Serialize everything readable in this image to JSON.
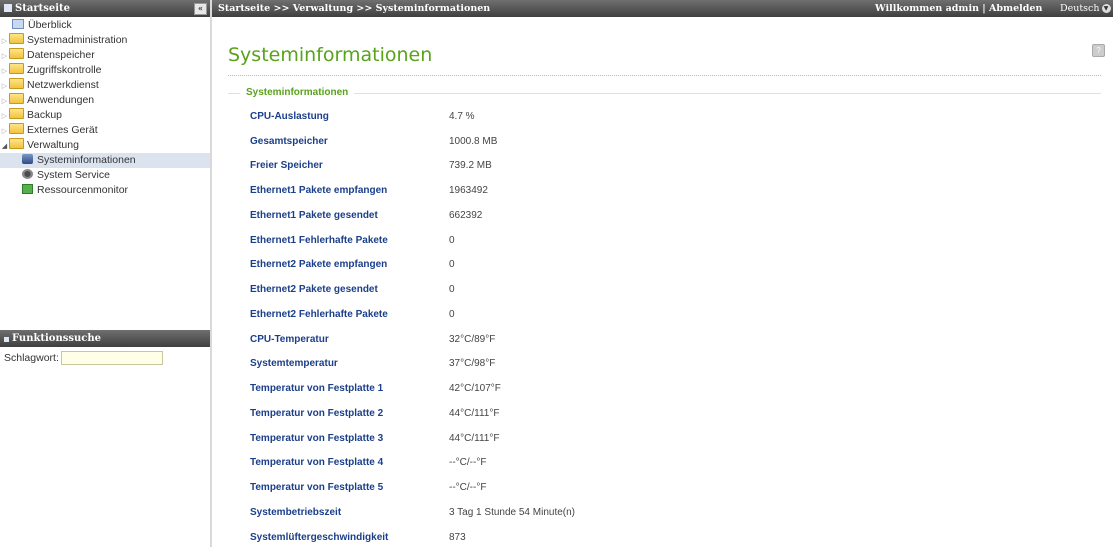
{
  "sidebar": {
    "header": "Startseite",
    "collapse_icon": "«",
    "items": [
      {
        "label": "Überblick"
      },
      {
        "label": "Systemadministration"
      },
      {
        "label": "Datenspeicher"
      },
      {
        "label": "Zugriffskontrolle"
      },
      {
        "label": "Netzwerkdienst"
      },
      {
        "label": "Anwendungen"
      },
      {
        "label": "Backup"
      },
      {
        "label": "Externes Gerät"
      },
      {
        "label": "Verwaltung"
      },
      {
        "label": "Systeminformationen"
      },
      {
        "label": "System Service"
      },
      {
        "label": "Ressourcenmonitor"
      }
    ]
  },
  "search": {
    "header": "Funktionssuche",
    "label": "Schlagwort:",
    "value": ""
  },
  "topbar": {
    "breadcrumb": "Startseite >> Verwaltung >> Systeminformationen",
    "welcome": "Willkommen admin | Abmelden",
    "language": "Deutsch"
  },
  "main": {
    "title": "Systeminformationen",
    "section_title": "Systeminformationen",
    "rows": [
      {
        "label": "CPU-Auslastung",
        "value": "4.7 %"
      },
      {
        "label": "Gesamtspeicher",
        "value": "1000.8 MB"
      },
      {
        "label": "Freier Speicher",
        "value": "739.2 MB"
      },
      {
        "label": "Ethernet1 Pakete empfangen",
        "value": "1963492"
      },
      {
        "label": "Ethernet1 Pakete gesendet",
        "value": "662392"
      },
      {
        "label": "Ethernet1 Fehlerhafte Pakete",
        "value": "0"
      },
      {
        "label": "Ethernet2 Pakete empfangen",
        "value": "0"
      },
      {
        "label": "Ethernet2 Pakete gesendet",
        "value": "0"
      },
      {
        "label": "Ethernet2 Fehlerhafte Pakete",
        "value": "0"
      },
      {
        "label": "CPU-Temperatur",
        "value": "32°C/89°F"
      },
      {
        "label": "Systemtemperatur",
        "value": "37°C/98°F"
      },
      {
        "label": "Temperatur von Festplatte 1",
        "value": "42°C/107°F"
      },
      {
        "label": "Temperatur von Festplatte 2",
        "value": "44°C/111°F"
      },
      {
        "label": "Temperatur von Festplatte 3",
        "value": "44°C/111°F"
      },
      {
        "label": "Temperatur von Festplatte 4",
        "value": "--°C/--°F"
      },
      {
        "label": "Temperatur von Festplatte 5",
        "value": "--°C/--°F"
      },
      {
        "label": "Systembetriebszeit",
        "value": "3 Tag 1 Stunde 54 Minute(n)"
      },
      {
        "label": "Systemlüftergeschwindigkeit",
        "value": "873"
      }
    ]
  },
  "colors": {
    "accent": "#5aa21c",
    "label_blue": "#1b3f8a",
    "header_dark": "#4a4a4a"
  }
}
